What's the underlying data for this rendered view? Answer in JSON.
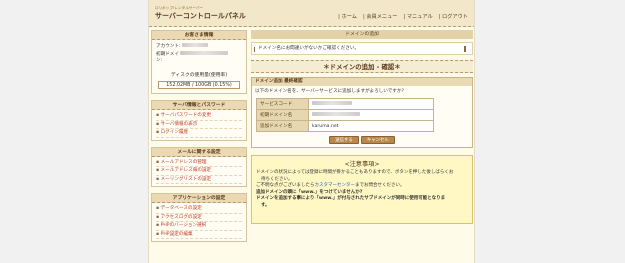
{
  "header": {
    "brand_sub": "ロリポップ!レンタルサーバー",
    "brand": "サーバーコントロールパネル",
    "nav": [
      "| ホーム",
      "| 会員メニュー",
      "| マニュアル",
      "| ログアウト"
    ]
  },
  "sidebar": {
    "account": {
      "title": "お客さま情報",
      "account_label": "アカウント:",
      "domain_label_1": "初期ドメイ",
      "domain_label_2": "ン:"
    },
    "disk": {
      "label": "ディスクの使用量(使用率)",
      "value": "152.02MB / 100GB (0.15%)"
    },
    "server_box": {
      "title": "サーバ情報とパスワード",
      "items": [
        "サーバパスワードの変更",
        "サーバ情報の表示",
        "ログイン履歴"
      ]
    },
    "mail_box": {
      "title": "メールに関する設定",
      "items": [
        "メールアドレスの管理",
        "メールアドレス毎の設定",
        "メーリングリストの設定"
      ]
    },
    "app_box": {
      "title": "アプリケーションの設定",
      "items": [
        "データベースの設定",
        "アクセスログの設定",
        "PHPのバージョン選択",
        "PHP設定の編集"
      ]
    }
  },
  "main": {
    "page_bar": "ドメインの追加",
    "notice": "ドメイン名にお間違いがないかご確認ください。",
    "section_title": "＊ドメインの追加 - 確認＊",
    "panel": {
      "title": "ドメイン追加 最終確認",
      "message": "以下のドメイン名を、サーバーサービスに追加しますがよろしいですか?",
      "rows": [
        {
          "key": "サービスコード",
          "value": ""
        },
        {
          "key": "初期ドメイン名",
          "value": ""
        },
        {
          "key": "追加ドメイン名",
          "value": "karuma.net"
        }
      ],
      "submit_label": "送信する",
      "cancel_label": "キャンセル"
    },
    "warning": {
      "title": "<注意事項>",
      "line1": "ドメインの状況によっては登録に時間が掛かることもありますので、ボタンを押した後しばらくお",
      "line1b": "待ちください。",
      "line2_pre": "ご不明な点がございましたら",
      "line2_link": "カスタマーセンター",
      "line2_post": "までお問合せください。",
      "line3": "追加ドメインの頭に「www.」をつけていませんか?",
      "line4": "ドメインを追加する事により「www.」が付与されたサブドメインが同時に使用可能となりま",
      "line4b": "す。"
    }
  }
}
